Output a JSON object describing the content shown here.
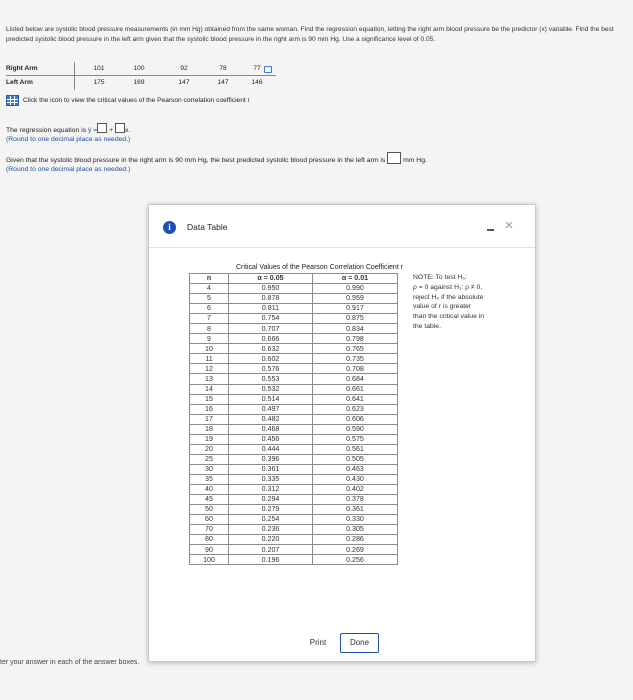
{
  "problem": {
    "intro": "Listed below are systolic blood pressure measurements (in mm Hg) obtained from the same woman. Find the regression equation, letting the right arm blood pressure be the predictor (x) variable. Find the best predicted systolic blood pressure in the left arm given that the systolic blood pressure in the right arm is 90 mm Hg. Use a significance level of 0.05.",
    "right_arm_label": "Right Arm",
    "left_arm_label": "Left Arm",
    "right_arm_values": [
      "101",
      "100",
      "92",
      "78",
      "77"
    ],
    "left_arm_values": [
      "175",
      "169",
      "147",
      "147",
      "146"
    ],
    "critical_link_text": "Click the icon to view the critical values of the Pearson correlation coefficient r",
    "q1_prefix": "The regression equation is",
    "q1_yhat": "ŷ =",
    "q1_plus": "+",
    "q1_x": "x.",
    "q1_note": "(Round to one decimal place as needed.)",
    "q2_text": "Given that the systolic blood pressure in the right arm is 90 mm Hg, the best predicted systolic blood pressure in the left arm is",
    "q2_unit": "mm Hg.",
    "q2_note": "(Round to one decimal place as needed.)",
    "footer": "ter your answer in each of the answer boxes."
  },
  "dialog": {
    "title": "Data Table",
    "table_title": "Critical Values of the Pearson Correlation Coefficient r",
    "col_n": "n",
    "col_a": "α = 0.05",
    "col_b": "α = 0.01",
    "rows": [
      [
        "4",
        "0.950",
        "0.990"
      ],
      [
        "5",
        "0.878",
        "0.959"
      ],
      [
        "6",
        "0.811",
        "0.917"
      ],
      [
        "7",
        "0.754",
        "0.875"
      ],
      [
        "8",
        "0.707",
        "0.834"
      ],
      [
        "9",
        "0.666",
        "0.798"
      ],
      [
        "10",
        "0.632",
        "0.765"
      ],
      [
        "11",
        "0.602",
        "0.735"
      ],
      [
        "12",
        "0.576",
        "0.708"
      ],
      [
        "13",
        "0.553",
        "0.684"
      ],
      [
        "14",
        "0.532",
        "0.661"
      ],
      [
        "15",
        "0.514",
        "0.641"
      ],
      [
        "16",
        "0.497",
        "0.623"
      ],
      [
        "17",
        "0.482",
        "0.606"
      ],
      [
        "18",
        "0.468",
        "0.590"
      ],
      [
        "19",
        "0.456",
        "0.575"
      ],
      [
        "20",
        "0.444",
        "0.561"
      ],
      [
        "25",
        "0.396",
        "0.505"
      ],
      [
        "30",
        "0.361",
        "0.463"
      ],
      [
        "35",
        "0.335",
        "0.430"
      ],
      [
        "40",
        "0.312",
        "0.402"
      ],
      [
        "45",
        "0.294",
        "0.378"
      ],
      [
        "50",
        "0.279",
        "0.361"
      ],
      [
        "60",
        "0.254",
        "0.330"
      ],
      [
        "70",
        "0.236",
        "0.305"
      ],
      [
        "80",
        "0.220",
        "0.286"
      ],
      [
        "90",
        "0.207",
        "0.269"
      ],
      [
        "100",
        "0.196",
        "0.256"
      ]
    ],
    "note_lines": [
      "NOTE: To test H₀:",
      "ρ = 0 against H₁: ρ ≠ 0,",
      "reject H₀ if the absolute",
      "value of r is greater",
      "than the critical value in",
      "the table."
    ],
    "print_label": "Print",
    "done_label": "Done"
  },
  "icons": {
    "info": "info-icon",
    "minimize": "minimize-icon",
    "close": "close-icon",
    "grid": "table-grid-icon",
    "copy": "copy-icon"
  },
  "colors": {
    "accent": "#1e4fb5",
    "grid_icon": "#3a7bd5"
  }
}
